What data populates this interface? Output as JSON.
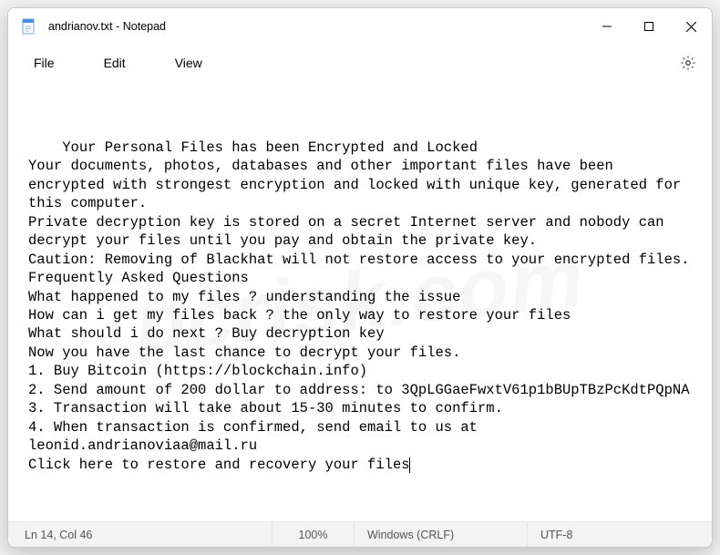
{
  "window": {
    "title": "andrianov.txt - Notepad"
  },
  "menu": {
    "file": "File",
    "edit": "Edit",
    "view": "View"
  },
  "content": {
    "text": "Your Personal Files has been Encrypted and Locked\nYour documents, photos, databases and other important files have been encrypted with strongest encryption and locked with unique key, generated for this computer.\nPrivate decryption key is stored on a secret Internet server and nobody can decrypt your files until you pay and obtain the private key.\nCaution: Removing of Blackhat will not restore access to your encrypted files.\nFrequently Asked Questions\nWhat happened to my files ? understanding the issue\nHow can i get my files back ? the only way to restore your files\nWhat should i do next ? Buy decryption key\nNow you have the last chance to decrypt your files.\n1. Buy Bitcoin (https://blockchain.info)\n2. Send amount of 200 dollar to address: to 3QpLGGaeFwxtV61p1bBUpTBzPcKdtPQpNA\n3. Transaction will take about 15-30 minutes to confirm.\n4. When transaction is confirmed, send email to us at leonid.andrianoviaa@mail.ru\nClick here to restore and recovery your files"
  },
  "status": {
    "cursor": "Ln 14, Col 46",
    "zoom": "100%",
    "eol": "Windows (CRLF)",
    "encoding": "UTF-8"
  }
}
